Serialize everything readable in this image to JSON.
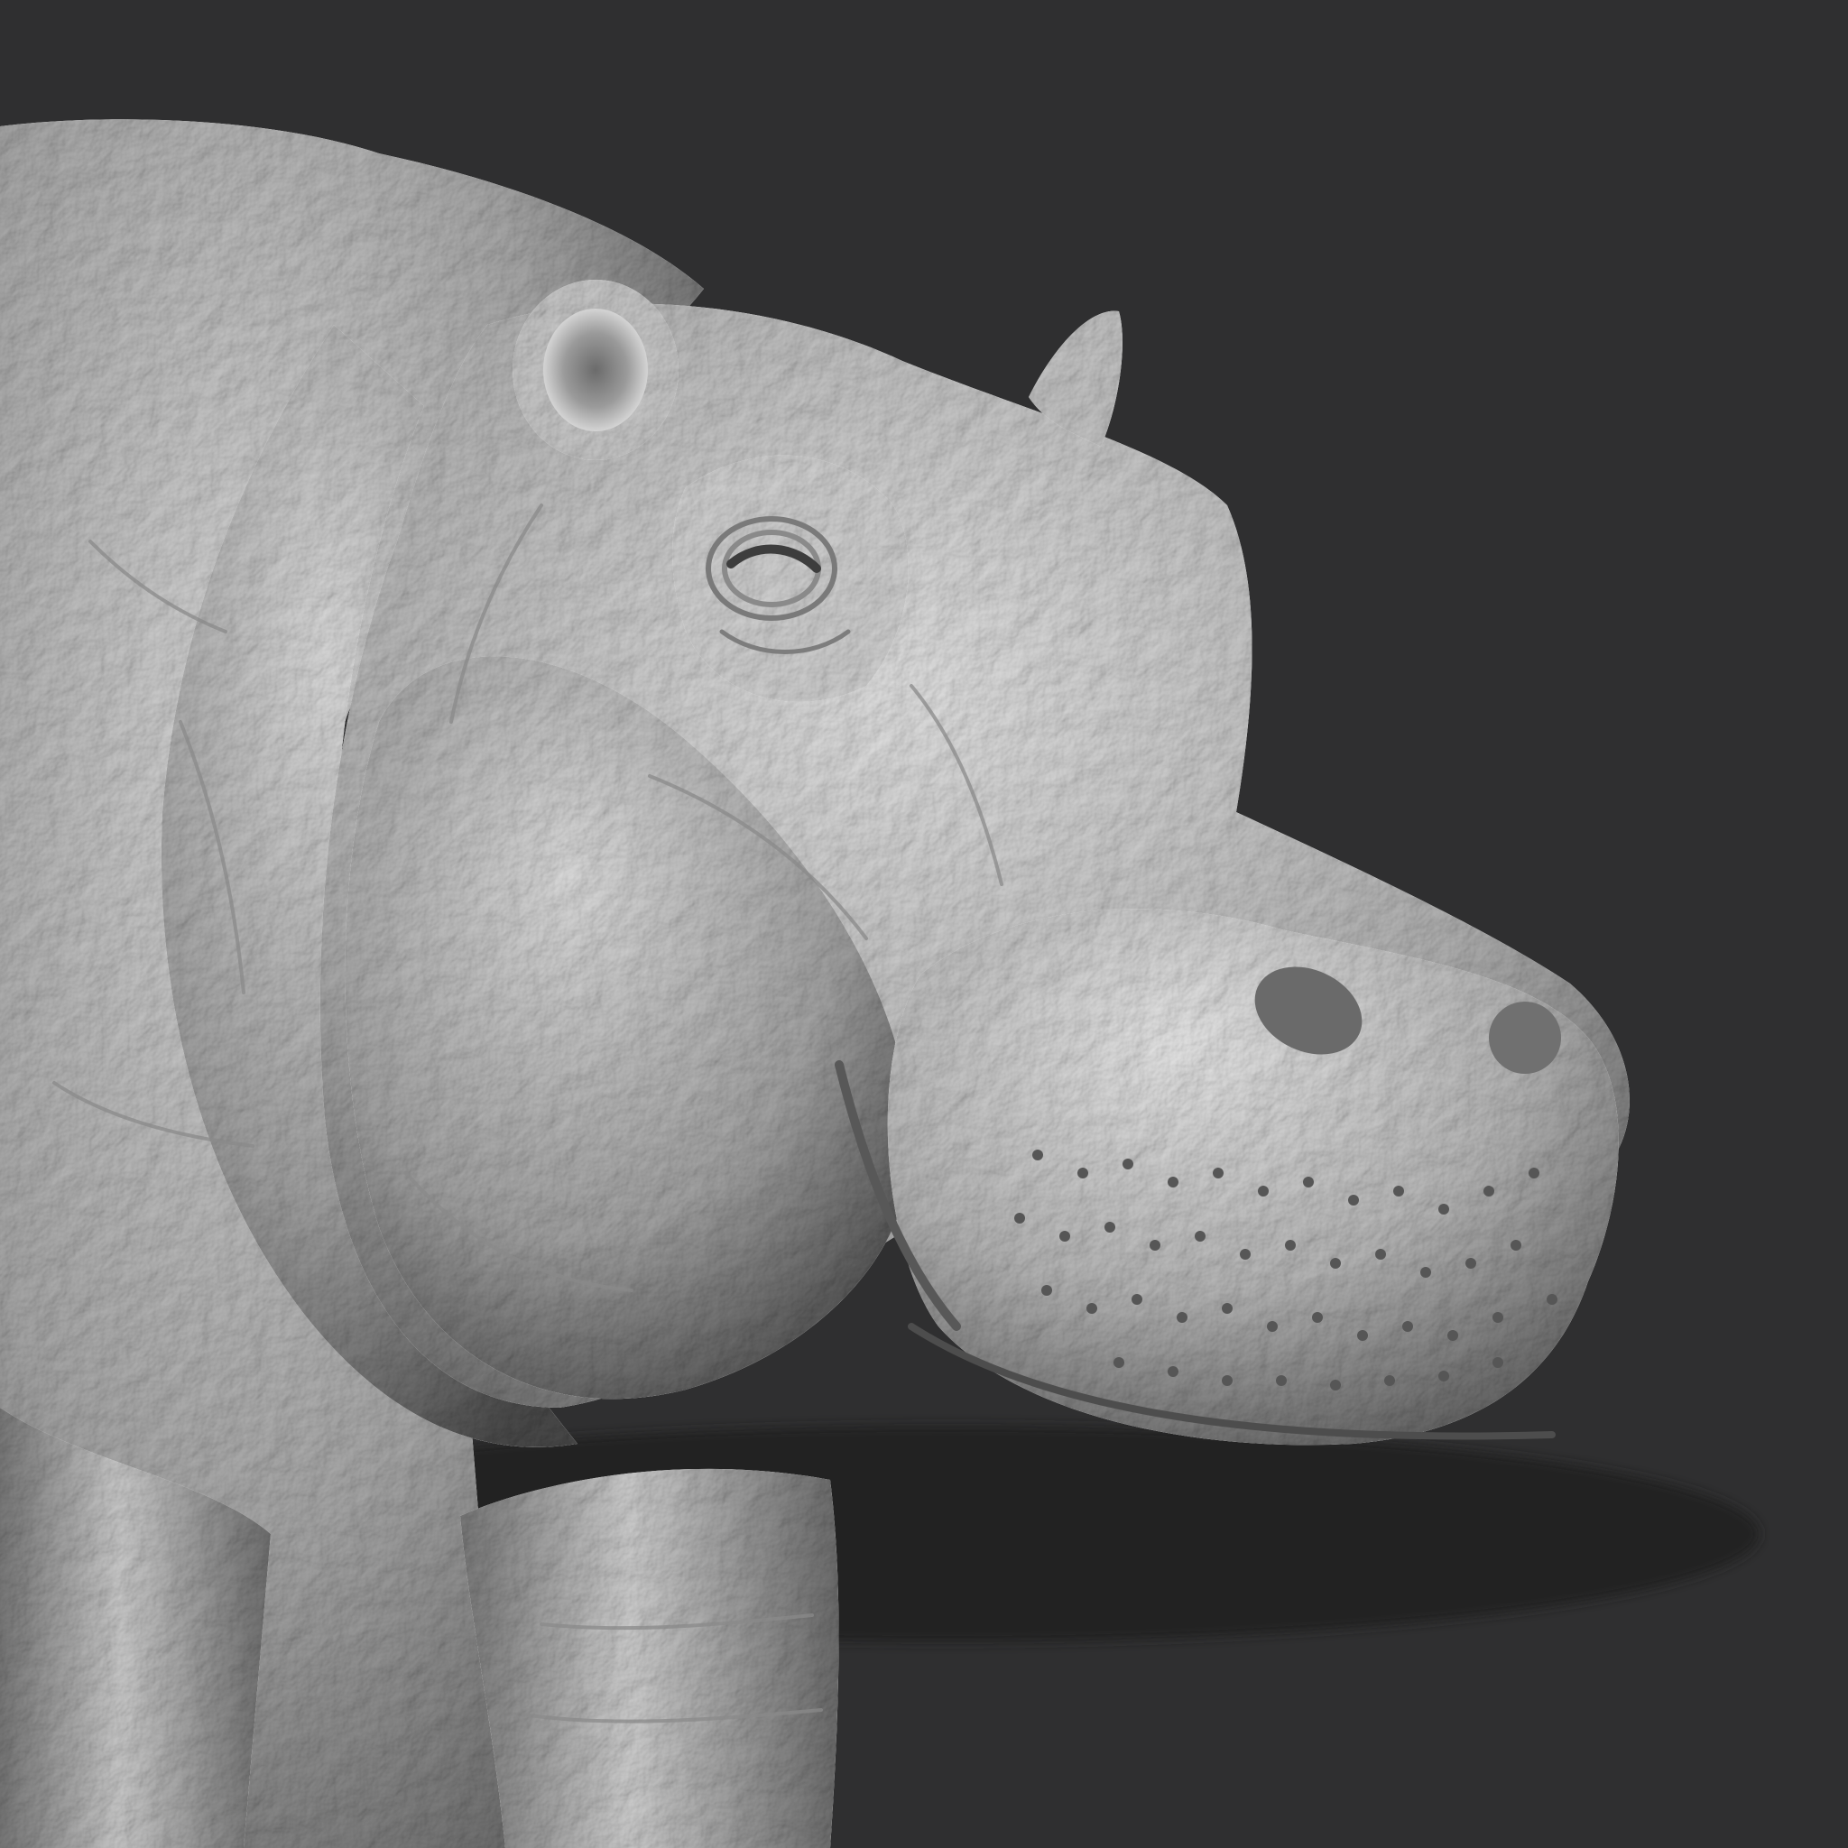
{
  "scene": {
    "subject": "hippo-sculpt",
    "background_color": "#2f2f30",
    "material": {
      "base_color": "#a9a9a9",
      "highlight_color": "#e6e6e6",
      "shadow_color": "#2a2a2a"
    }
  }
}
